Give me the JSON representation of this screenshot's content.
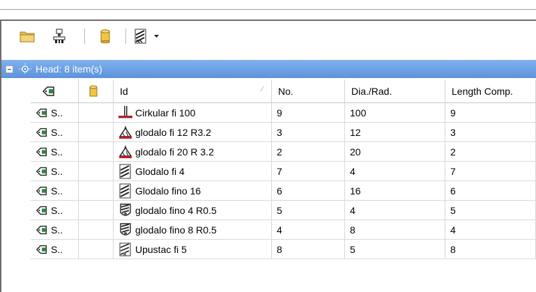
{
  "toolbar": {
    "buttons": [
      {
        "name": "folder-icon"
      },
      {
        "name": "tool-machine-icon"
      },
      {
        "name": "cylinder-icon"
      },
      {
        "name": "tool-type-icon"
      },
      {
        "name": "dropdown-arrow-icon"
      }
    ]
  },
  "group": {
    "label": "Head: 8 item(s)"
  },
  "columns": {
    "icon": "",
    "db": "",
    "id": "Id",
    "no": "No.",
    "dia": "Dia./Rad.",
    "length": "Length Comp."
  },
  "rows": [
    {
      "type": "S..",
      "tool_icon": "saw-blade-icon",
      "id": "Cirkular fi 100",
      "no": "9",
      "dia": "100",
      "length": "9"
    },
    {
      "type": "S..",
      "tool_icon": "cone-mill-icon",
      "id": "glodalo fi 12 R3.2",
      "no": "3",
      "dia": "12",
      "length": "3"
    },
    {
      "type": "S..",
      "tool_icon": "cone-mill-icon",
      "id": "glodalo fi 20 R 3.2",
      "no": "2",
      "dia": "20",
      "length": "2"
    },
    {
      "type": "S..",
      "tool_icon": "end-mill-icon",
      "id": "Glodalo fi 4",
      "no": "7",
      "dia": "4",
      "length": "7"
    },
    {
      "type": "S..",
      "tool_icon": "end-mill-icon",
      "id": "Glodalo fino 16",
      "no": "6",
      "dia": "16",
      "length": "6"
    },
    {
      "type": "S..",
      "tool_icon": "finishing-mill-icon",
      "id": "glodalo fino 4 R0.5",
      "no": "5",
      "dia": "4",
      "length": "5"
    },
    {
      "type": "S..",
      "tool_icon": "finishing-mill-icon",
      "id": "glodalo fino 8 R0.5",
      "no": "4",
      "dia": "8",
      "length": "4"
    },
    {
      "type": "S..",
      "tool_icon": "groove-mill-icon",
      "id": "Upustac fi 5",
      "no": "8",
      "dia": "5",
      "length": "8"
    }
  ]
}
